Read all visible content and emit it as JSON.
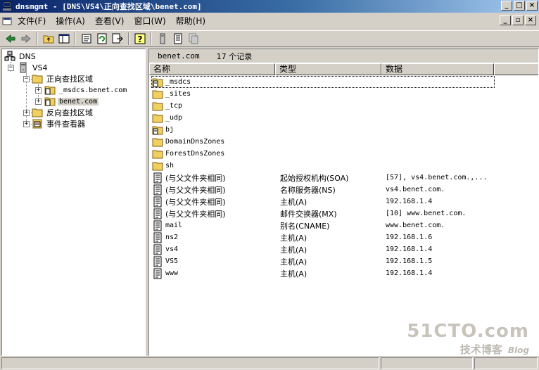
{
  "window": {
    "title": "dnsmgmt - [DNS\\VS4\\正向查找区域\\benet.com]",
    "controls": [
      "_",
      "□",
      "×"
    ],
    "mdi_controls": [
      "_",
      "▫",
      "×"
    ]
  },
  "menu": [
    "文件(F)",
    "操作(A)",
    "查看(V)",
    "窗口(W)",
    "帮助(H)"
  ],
  "toolbar": [
    "back-arrow-icon",
    "forward-arrow-icon",
    "up-folder-icon",
    "show-tree-icon",
    "properties-icon",
    "refresh-icon",
    "export-icon",
    "help-icon",
    "server-icon",
    "document-icon",
    "copy-icon"
  ],
  "tree": {
    "root": "DNS",
    "server": "VS4",
    "forward_zones": "正向查找区域",
    "zone_msdcs": "_msdcs.benet.com",
    "zone_benet": "benet.com",
    "reverse_zones": "反向查找区域",
    "event_viewer": "事件查看器"
  },
  "right_header": {
    "zone": "benet.com",
    "count": "17 个记录"
  },
  "columns": [
    "名称",
    "类型",
    "数据"
  ],
  "rows": [
    {
      "name": "_msdcs",
      "type": "",
      "data": "",
      "icon": "folder-zone"
    },
    {
      "name": "_sites",
      "type": "",
      "data": "",
      "icon": "folder"
    },
    {
      "name": "_tcp",
      "type": "",
      "data": "",
      "icon": "folder"
    },
    {
      "name": "_udp",
      "type": "",
      "data": "",
      "icon": "folder"
    },
    {
      "name": "bj",
      "type": "",
      "data": "",
      "icon": "folder-zone"
    },
    {
      "name": "DomainDnsZones",
      "type": "",
      "data": "",
      "icon": "folder"
    },
    {
      "name": "ForestDnsZones",
      "type": "",
      "data": "",
      "icon": "folder"
    },
    {
      "name": "sh",
      "type": "",
      "data": "",
      "icon": "folder"
    },
    {
      "name": "(与父文件夹相同)",
      "type": "起始授权机构(SOA)",
      "data": "[57], vs4.benet.com.,...",
      "icon": "record"
    },
    {
      "name": "(与父文件夹相同)",
      "type": "名称服务器(NS)",
      "data": "vs4.benet.com.",
      "icon": "record"
    },
    {
      "name": "(与父文件夹相同)",
      "type": "主机(A)",
      "data": "192.168.1.4",
      "icon": "record"
    },
    {
      "name": "(与父文件夹相同)",
      "type": "邮件交换器(MX)",
      "data": "[10]  www.benet.com.",
      "icon": "record"
    },
    {
      "name": "mail",
      "type": "别名(CNAME)",
      "data": "www.benet.com.",
      "icon": "record"
    },
    {
      "name": "ns2",
      "type": "主机(A)",
      "data": "192.168.1.6",
      "icon": "record"
    },
    {
      "name": "vs4",
      "type": "主机(A)",
      "data": "192.168.1.4",
      "icon": "record"
    },
    {
      "name": "VS5",
      "type": "主机(A)",
      "data": "192.168.1.5",
      "icon": "record"
    },
    {
      "name": "www",
      "type": "主机(A)",
      "data": "192.168.1.4",
      "icon": "record"
    }
  ],
  "watermark": {
    "line1": "51CTO.com",
    "line2": "技术博客",
    "line3": "Blog"
  }
}
